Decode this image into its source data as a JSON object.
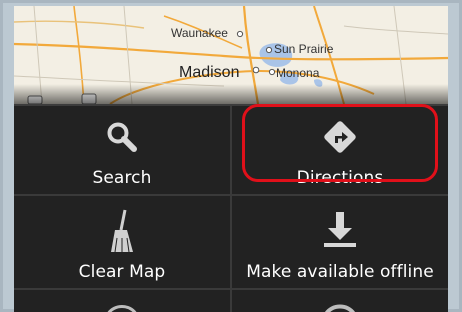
{
  "map": {
    "places": {
      "waunakee": "Waunakee",
      "sun_prairie": "Sun Prairie",
      "madison": "Madison",
      "monona": "Monona"
    }
  },
  "menu": {
    "items": [
      {
        "label": "Search",
        "icon": "search-icon"
      },
      {
        "label": "Directions",
        "icon": "directions-icon"
      },
      {
        "label": "Clear Map",
        "icon": "broom-icon"
      },
      {
        "label": "Make available offline",
        "icon": "download-icon"
      }
    ]
  },
  "colors": {
    "menu_bg": "#222222",
    "highlight": "#e0101a",
    "label": "#ffffff"
  }
}
